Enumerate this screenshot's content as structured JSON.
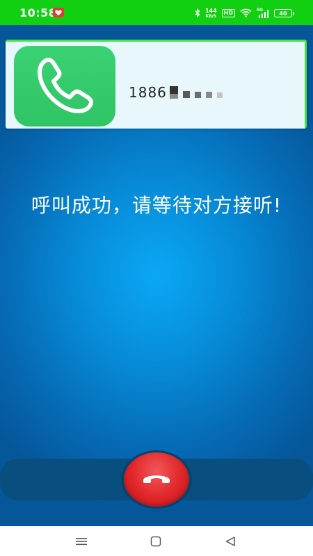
{
  "status_bar": {
    "time": "10:58",
    "network_speed_value": "144",
    "network_speed_unit": "KB/S",
    "hd_badge": "HD",
    "signal_label": "5G",
    "battery_level": "40"
  },
  "call": {
    "caller_number": "1886",
    "status_message": "呼叫成功，请等待对方接听!"
  },
  "colors": {
    "status_bar_bg": "#11d011",
    "call_area_center": "#0aa8f5",
    "call_area_edge": "#05579a",
    "card_bg": "#e7f7fb",
    "card_border": "#4ce04c",
    "phone_tile_green": "#2fc464",
    "hangup_red": "#e02528"
  },
  "icons": {
    "status_app": "heart-app-icon",
    "bluetooth": "bluetooth-icon",
    "wifi": "wifi-icon",
    "signal": "signal-bars-icon",
    "battery": "battery-icon",
    "phone": "phone-handset-icon",
    "hangup": "hangup-phone-icon",
    "nav_menu": "menu-icon",
    "nav_home": "home-square-icon",
    "nav_back": "back-triangle-icon"
  }
}
